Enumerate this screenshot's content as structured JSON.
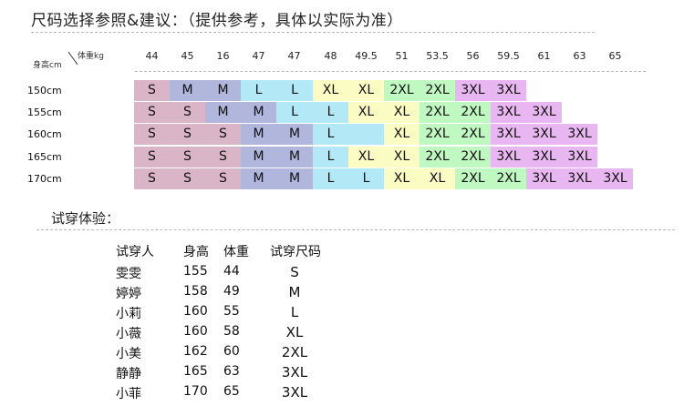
{
  "title": "尺码选择参照&建议：（提供参考，具体以实际为准）",
  "header": {
    "height_label": "身高cm",
    "weight_label": "体重kg"
  },
  "weights": [
    "44",
    "45",
    "16",
    "47",
    "47",
    "48",
    "49.5",
    "51",
    "53.5",
    "56",
    "59.5",
    "61",
    "63",
    "65"
  ],
  "heights": [
    "150cm",
    "155cm",
    "160cm",
    "165cm",
    "170cm"
  ],
  "size_colors": {
    "S": "#dab4c7",
    "M": "#b0b6dc",
    "L": "#b3e9f6",
    "XL": "#fbfbc4",
    "2XL": "#c0f8c2",
    "3XL": "#e8b6f0"
  },
  "grid": [
    [
      "S",
      "M",
      "M",
      "L",
      "L",
      "XL",
      "XL",
      "2XL",
      "2XL",
      "3XL",
      "3XL",
      "",
      "",
      ""
    ],
    [
      "S",
      "S",
      "M",
      "M",
      "L",
      "L",
      "XL",
      "XL",
      "2XL",
      "2XL",
      "3XL",
      "3XL",
      "",
      ""
    ],
    [
      "S",
      "S",
      "S",
      "M",
      "M",
      "L",
      "",
      "XL",
      "2XL",
      "2XL",
      "3XL",
      "3XL",
      "3XL",
      ""
    ],
    [
      "S",
      "S",
      "S",
      "M",
      "M",
      "L",
      "XL",
      "XL",
      "2XL",
      "2XL",
      "3XL",
      "3XL",
      "3XL",
      ""
    ],
    [
      "S",
      "S",
      "S",
      "M",
      "M",
      "L",
      "L",
      "XL",
      "XL",
      "2XL",
      "2XL",
      "3XL",
      "3XL",
      "3XL"
    ]
  ],
  "trial": {
    "section_title": "试穿体验：",
    "headers": [
      "试穿人",
      "身高",
      "体重",
      "试穿尺码"
    ],
    "rows": [
      [
        "雯雯",
        "155",
        "44",
        "S"
      ],
      [
        "婷婷",
        "158",
        "49",
        "M"
      ],
      [
        "小莉",
        "160",
        "55",
        "L"
      ],
      [
        "小薇",
        "160",
        "58",
        "XL"
      ],
      [
        "小美",
        "162",
        "60",
        "2XL"
      ],
      [
        "静静",
        "165",
        "63",
        "3XL"
      ],
      [
        "小菲",
        "170",
        "65",
        "3XL"
      ]
    ]
  }
}
